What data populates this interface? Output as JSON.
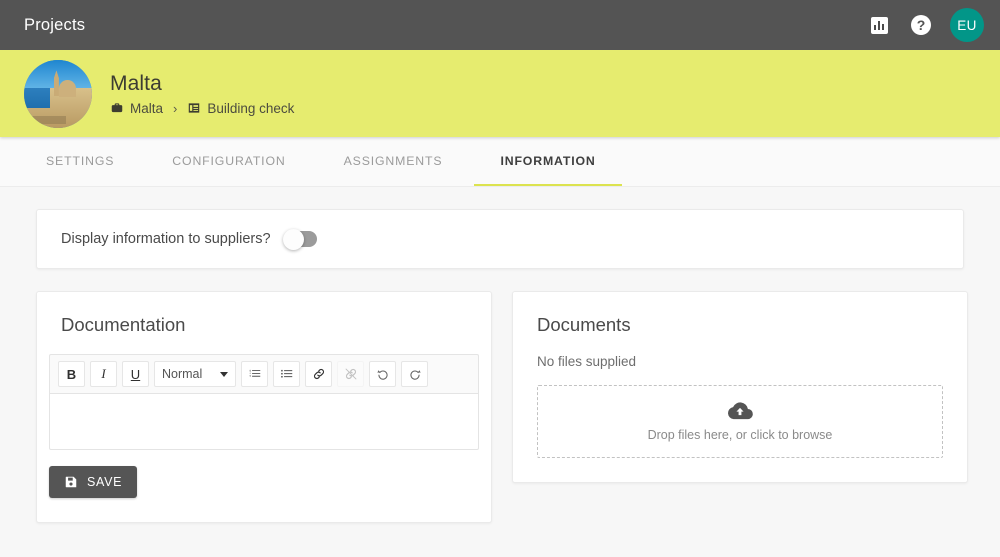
{
  "topbar": {
    "title": "Projects",
    "reports_icon": "bar-chart-icon",
    "help_icon": "help-icon",
    "help_glyph": "?",
    "avatar_initials": "EU",
    "avatar_color": "#029688",
    "background": "#545454"
  },
  "banner": {
    "background": "#e6ec6f",
    "project_name": "Malta",
    "avatar_icon": "project-photo-malta",
    "breadcrumb": [
      {
        "icon": "briefcase-icon",
        "label": "Malta"
      },
      {
        "icon": "form-icon",
        "label": "Building check"
      }
    ],
    "separator": "›"
  },
  "tabs": [
    {
      "label": "SETTINGS",
      "active": false
    },
    {
      "label": "CONFIGURATION",
      "active": false
    },
    {
      "label": "ASSIGNMENTS",
      "active": false
    },
    {
      "label": "INFORMATION",
      "active": true
    }
  ],
  "tab_accent_color": "#dce34f",
  "toggle_row": {
    "label": "Display information to suppliers?",
    "state": "off"
  },
  "documentation": {
    "title": "Documentation",
    "toolbar": {
      "bold": "B",
      "italic": "I",
      "underline": "U",
      "format_value": "Normal",
      "ordered_list_icon": "ordered-list-icon",
      "bullet_list_icon": "bullet-list-icon",
      "link_icon": "link-icon",
      "unlink_icon": "unlink-icon",
      "undo_icon": "undo-icon",
      "redo_icon": "redo-icon"
    },
    "editor_value": "",
    "save_label": "SAVE",
    "save_icon": "save-icon"
  },
  "documents": {
    "title": "Documents",
    "empty_text": "No files supplied",
    "dropzone_text": "Drop files here, or click to browse",
    "dropzone_icon": "cloud-upload-icon"
  }
}
